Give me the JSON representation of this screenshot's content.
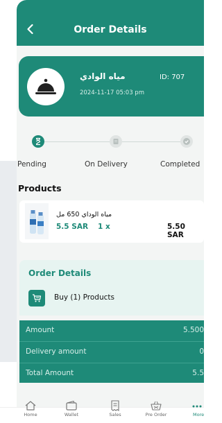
{
  "header": {
    "title": "Order Details"
  },
  "order": {
    "store_name": "مياه الوادي",
    "id_label": "ID: 707",
    "date": "2024-11-17 05:03 pm"
  },
  "status_steps": [
    {
      "label": "Pending",
      "state": "active"
    },
    {
      "label": "On Delivery",
      "state": "inactive"
    },
    {
      "label": "Completed",
      "state": "inactive"
    }
  ],
  "products_section": {
    "title": "Products"
  },
  "product": {
    "name": "مياه الوداي 650 مل",
    "price": "5.5 SAR",
    "quantity": "1 x",
    "total": "5.50 SAR"
  },
  "order_details": {
    "title": "Order Details",
    "buy_text": "Buy (1) Products"
  },
  "summary": {
    "amount_label": "Amount",
    "amount_value": "5.500",
    "delivery_label": "Delivery amount",
    "delivery_value": "0",
    "total_label": "Total Amount",
    "total_value": "5.5"
  },
  "nav": [
    {
      "label": "Home",
      "icon": "home-icon"
    },
    {
      "label": "Wallet",
      "icon": "wallet-icon"
    },
    {
      "label": "Sales",
      "icon": "receipt-icon"
    },
    {
      "label": "Pre Order",
      "icon": "basket-icon"
    },
    {
      "label": "More",
      "icon": "more-icon"
    }
  ],
  "colors": {
    "primary": "#1e8a78",
    "light": "#e7f4f1",
    "background": "#f3f5f4"
  }
}
